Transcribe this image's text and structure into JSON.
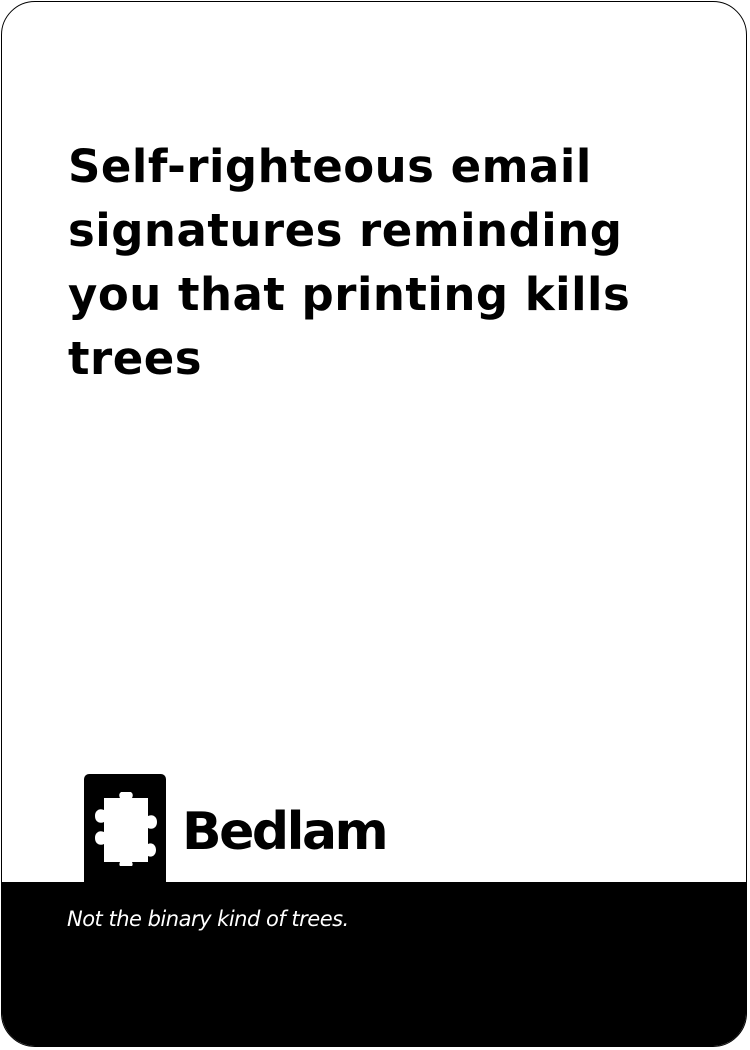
{
  "card": {
    "prompt": "Self-righteous email signatures reminding you that printing kills trees",
    "flavor_text": "Not the binary kind of trees."
  },
  "brand": {
    "name": "Bedlam",
    "icon": "puzzle-piece-icon"
  },
  "colors": {
    "card_background": "#ffffff",
    "footer_background": "#000000",
    "text": "#000000",
    "footer_text": "#ffffff"
  }
}
